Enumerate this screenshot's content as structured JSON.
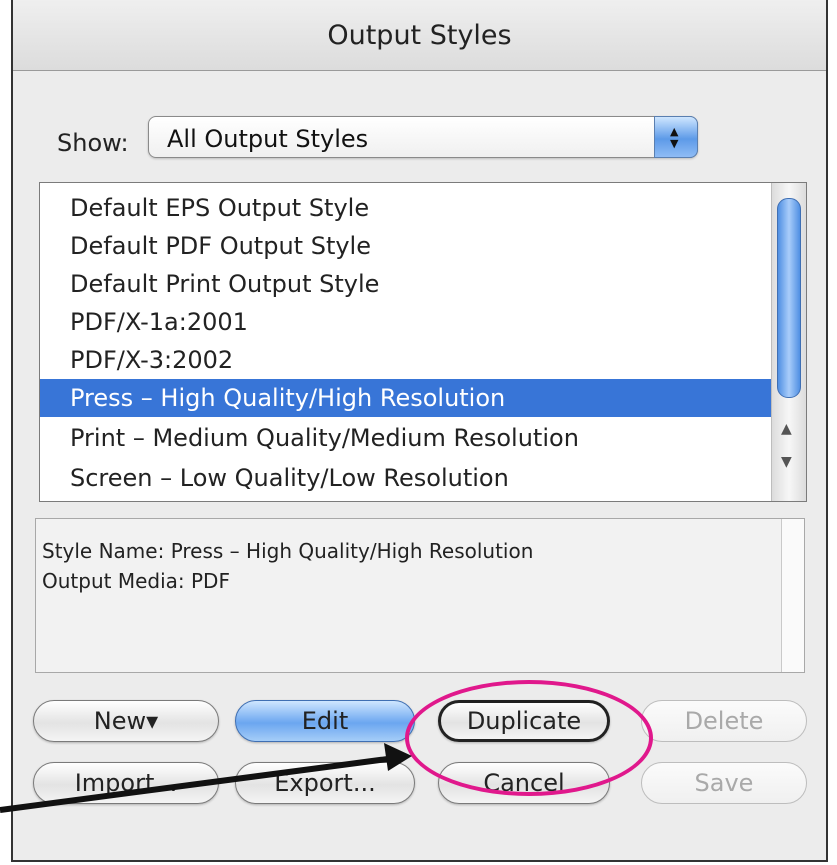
{
  "window": {
    "title": "Output Styles"
  },
  "show": {
    "label": "Show:",
    "selected": "All Output Styles"
  },
  "styles_list": {
    "items": [
      {
        "label": "Default EPS Output Style",
        "selected": false
      },
      {
        "label": "Default PDF Output Style",
        "selected": false
      },
      {
        "label": "Default Print Output Style",
        "selected": false
      },
      {
        "label": "PDF/X-1a:2001",
        "selected": false
      },
      {
        "label": "PDF/X-3:2002",
        "selected": false
      },
      {
        "label": "Press – High Quality/High Resolution",
        "selected": true
      },
      {
        "label": "Print – Medium Quality/Medium Resolution",
        "selected": false
      },
      {
        "label": "Screen – Low Quality/Low Resolution",
        "selected": false
      }
    ]
  },
  "description": {
    "line1": "Style Name: Press – High Quality/High Resolution",
    "line2": "Output Media: PDF"
  },
  "buttons": {
    "new": "New▾",
    "edit": "Edit",
    "duplicate": "Duplicate",
    "delete": "Delete",
    "import": "Import...",
    "export": "Export...",
    "cancel": "Cancel",
    "save": "Save"
  },
  "colors": {
    "selection": "#3875d7",
    "highlight": "#e0188c"
  }
}
